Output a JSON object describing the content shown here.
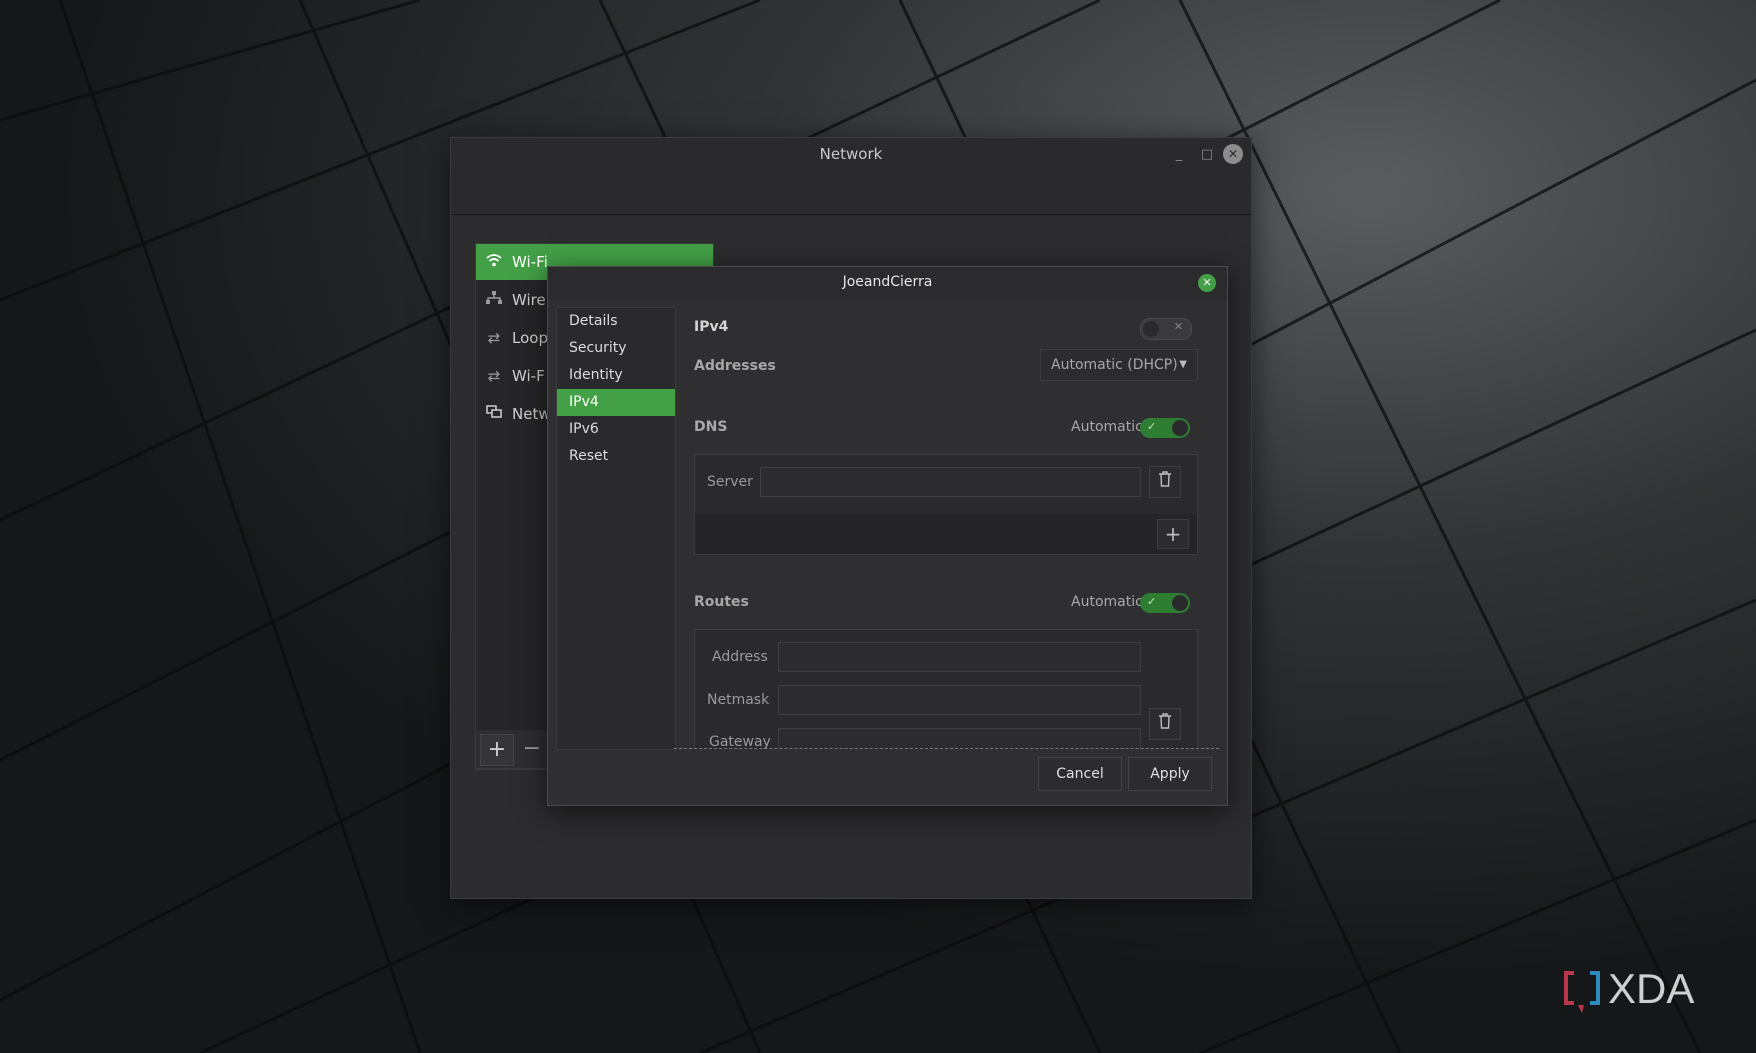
{
  "wallpaper": {
    "brand": "XDA"
  },
  "main_window": {
    "title": "Network",
    "controls": {
      "minimize": "_",
      "maximize": "□",
      "close": "✕"
    },
    "connections": [
      {
        "label": "Wi-Fi",
        "icon": "wifi-icon",
        "selected": true
      },
      {
        "label": "Wire",
        "icon": "wired-icon",
        "selected": false
      },
      {
        "label": "Loop",
        "icon": "loopback-icon",
        "selected": false
      },
      {
        "label": "Wi-F",
        "icon": "arrows-icon",
        "selected": false
      },
      {
        "label": "Netw",
        "icon": "network-icon",
        "selected": false
      }
    ],
    "toolbar": {
      "add": "+",
      "remove": "−"
    }
  },
  "dialog": {
    "title": "JoeandCierra",
    "sidebar": [
      {
        "label": "Details",
        "selected": false
      },
      {
        "label": "Security",
        "selected": false
      },
      {
        "label": "Identity",
        "selected": false
      },
      {
        "label": "IPv4",
        "selected": true
      },
      {
        "label": "IPv6",
        "selected": false
      },
      {
        "label": "Reset",
        "selected": false
      }
    ],
    "ipv4": {
      "title": "IPv4",
      "enabled": false,
      "addresses_label": "Addresses",
      "addresses_value": "Automatic (DHCP)"
    },
    "dns": {
      "title": "DNS",
      "automatic_label": "Automatic",
      "automatic": true,
      "server_label": "Server",
      "server_value": ""
    },
    "routes": {
      "title": "Routes",
      "automatic_label": "Automatic",
      "automatic": true,
      "address_label": "Address",
      "netmask_label": "Netmask",
      "gateway_label": "Gateway"
    },
    "buttons": {
      "cancel": "Cancel",
      "apply": "Apply"
    }
  },
  "colors": {
    "accent": "#43a047",
    "window_bg": "#2c2c2e",
    "dialog_bg": "#2f2f31"
  }
}
